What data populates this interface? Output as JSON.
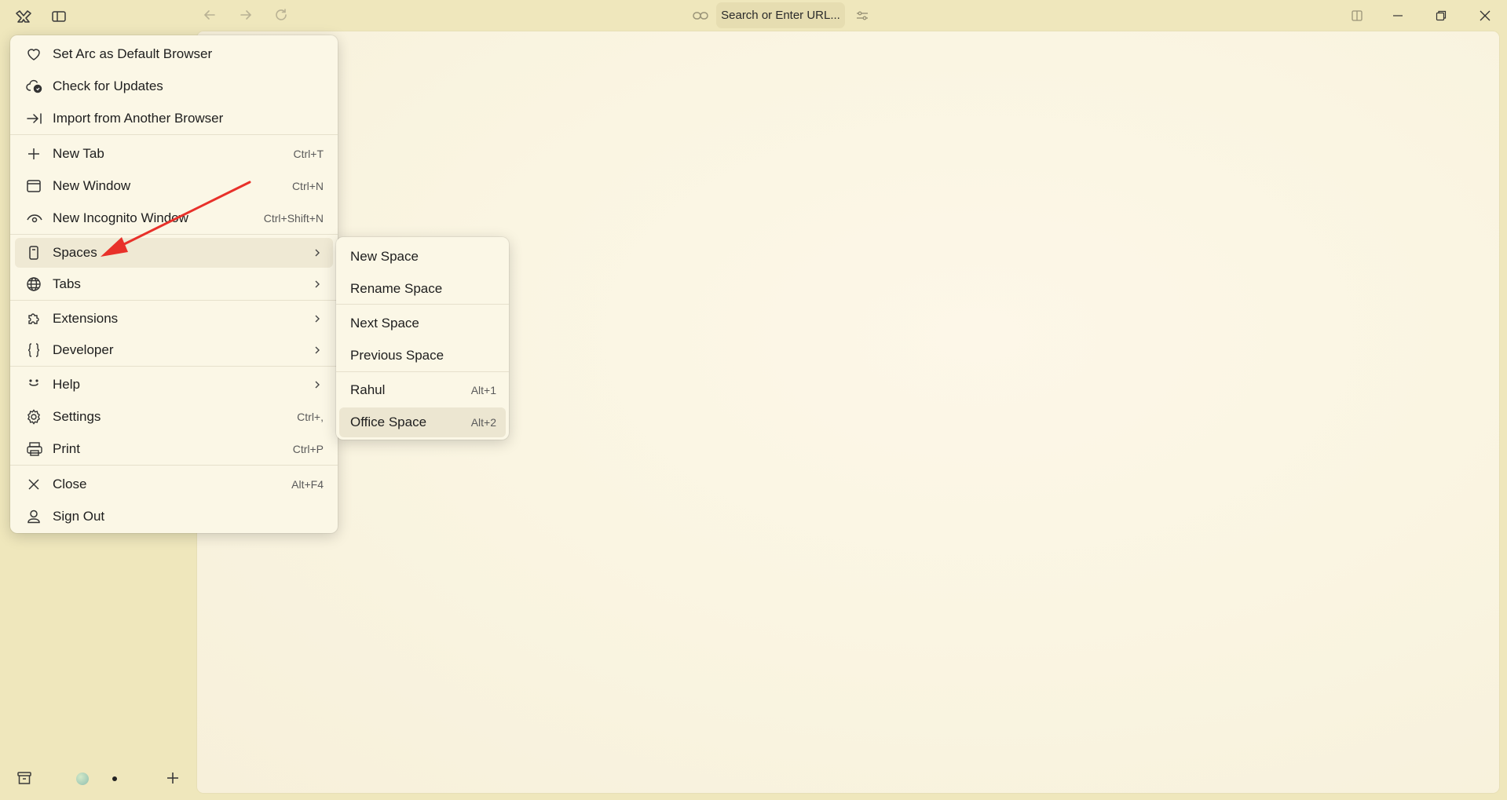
{
  "window": {
    "url_placeholder": "Search or Enter URL..."
  },
  "main_menu": {
    "items": [
      {
        "label": "Set Arc as Default Browser",
        "icon": "heart-icon",
        "shortcut": ""
      },
      {
        "label": "Check for Updates",
        "icon": "cloud-update-icon",
        "shortcut": ""
      },
      {
        "label": "Import from Another Browser",
        "icon": "import-arrow-icon",
        "shortcut": ""
      },
      {
        "label": "New Tab",
        "icon": "plus-icon",
        "shortcut": "Ctrl+T"
      },
      {
        "label": "New Window",
        "icon": "window-icon",
        "shortcut": "Ctrl+N"
      },
      {
        "label": "New Incognito Window",
        "icon": "incognito-eye-icon",
        "shortcut": "Ctrl+Shift+N"
      },
      {
        "label": "Spaces",
        "icon": "spaces-icon",
        "shortcut": "",
        "submenu": true
      },
      {
        "label": "Tabs",
        "icon": "globe-icon",
        "shortcut": "",
        "submenu": true
      },
      {
        "label": "Extensions",
        "icon": "puzzle-icon",
        "shortcut": "",
        "submenu": true
      },
      {
        "label": "Developer",
        "icon": "braces-icon",
        "shortcut": "",
        "submenu": true
      },
      {
        "label": "Help",
        "icon": "smile-icon",
        "shortcut": "",
        "submenu": true
      },
      {
        "label": "Settings",
        "icon": "gear-icon",
        "shortcut": "Ctrl+,"
      },
      {
        "label": "Print",
        "icon": "printer-icon",
        "shortcut": "Ctrl+P"
      },
      {
        "label": "Close",
        "icon": "close-icon",
        "shortcut": "Alt+F4"
      },
      {
        "label": "Sign Out",
        "icon": "user-icon",
        "shortcut": ""
      }
    ]
  },
  "spaces_submenu": {
    "items": [
      {
        "label": "New Space",
        "shortcut": ""
      },
      {
        "label": "Rename Space",
        "shortcut": ""
      },
      {
        "label": "Next Space",
        "shortcut": ""
      },
      {
        "label": "Previous Space",
        "shortcut": ""
      },
      {
        "label": "Rahul",
        "shortcut": "Alt+1"
      },
      {
        "label": "Office Space",
        "shortcut": "Alt+2"
      }
    ]
  },
  "colors": {
    "background": "#efe7bc",
    "menu": "#fbf7e6",
    "annotation_arrow": "#e8312a"
  }
}
